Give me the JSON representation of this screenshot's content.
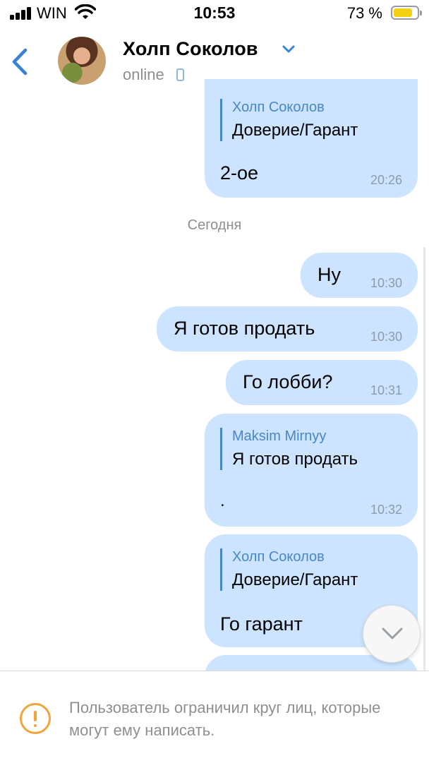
{
  "status_bar": {
    "carrier": "WIN",
    "time": "10:53",
    "battery": "73 %"
  },
  "header": {
    "name": "Холп Соколов",
    "status": "online"
  },
  "messages": [
    {
      "reply_author": "Холп Соколов",
      "reply_text": "Доверие/Гарант",
      "text": "2-ое",
      "time": "20:26"
    },
    {
      "text": "Ну",
      "time": "10:30"
    },
    {
      "text": "Я готов продать",
      "time": "10:30"
    },
    {
      "text": "Го лобби?",
      "time": "10:31"
    },
    {
      "reply_author": "Maksim Mirnyy",
      "reply_text": "Я готов продать",
      "text": ".",
      "time": "10:32"
    },
    {
      "reply_author": "Холп Соколов",
      "reply_text": "Доверие/Гарант",
      "text": "Го гарант",
      "time": ""
    }
  ],
  "date_separator": "Сегодня",
  "footer": {
    "notice": "Пользователь ограничил круг лиц, которые могут ему написать."
  },
  "colors": {
    "bubble": "#cce4ff",
    "accent": "#4a86c7",
    "warning": "#f3a33c"
  }
}
